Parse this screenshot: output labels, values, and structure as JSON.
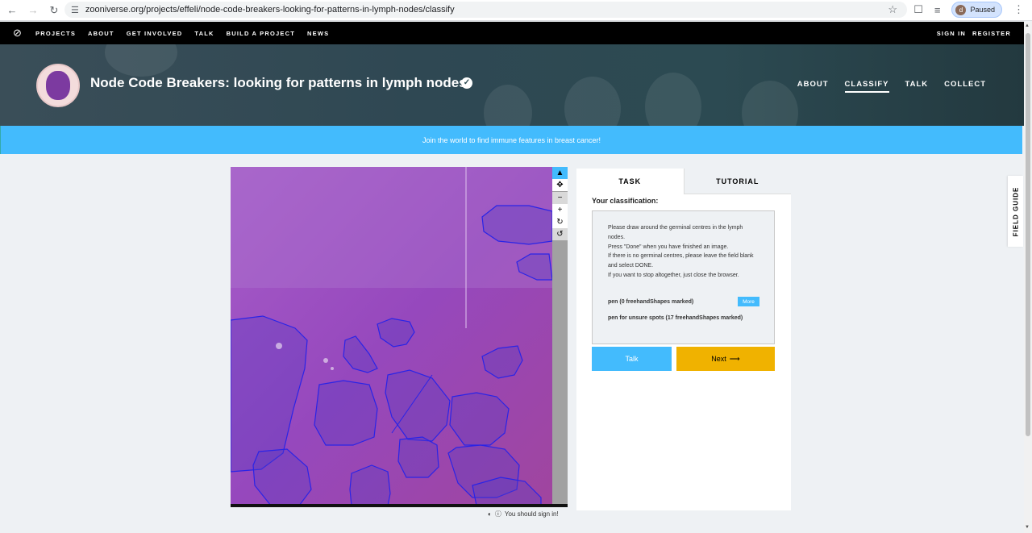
{
  "browser": {
    "url": "zooniverse.org/projects/effeli/node-code-breakers-looking-for-patterns-in-lymph-nodes/classify",
    "profile_initial": "d",
    "profile_status": "Paused"
  },
  "topnav": {
    "items": [
      "PROJECTS",
      "ABOUT",
      "GET INVOLVED",
      "TALK",
      "BUILD A PROJECT",
      "NEWS"
    ],
    "sign_in": "SIGN IN",
    "register": "REGISTER"
  },
  "project": {
    "title": "Node Code Breakers: looking for patterns in lymph nodes",
    "nav": [
      "ABOUT",
      "CLASSIFY",
      "TALK",
      "COLLECT"
    ],
    "active_nav": "CLASSIFY"
  },
  "banner": "Join the world to find immune features in breast cancer!",
  "panel": {
    "tabs": [
      "TASK",
      "TUTORIAL"
    ],
    "active_tab": "TASK",
    "classification_label": "Your classification:",
    "instructions": [
      "Please draw around the germinal centres in the lymph nodes.",
      "Press \"Done\" when you have finished an image.",
      "If there is no germinal centres, please leave the field blank and select DONE.",
      "If you want to stop altogether, just close the browser."
    ],
    "tools": [
      {
        "label": "pen (0 freehandShapes marked)"
      },
      {
        "label": "pen for unsure spots (17 freehandShapes marked)"
      }
    ],
    "more_label": "More",
    "talk_label": "Talk",
    "next_label": "Next",
    "next_icon": "arrow-right-icon"
  },
  "viewer": {
    "tools": [
      "pointer-icon",
      "move-icon",
      "zoom-out-icon",
      "zoom-in-icon",
      "rotate-icon",
      "reset-icon"
    ],
    "signin_note": "You should sign in!"
  },
  "field_guide": "FIELD GUIDE",
  "colors": {
    "accent_blue": "#43bbfd",
    "next_yellow": "#f0b200",
    "tissue_purple": "#9a4fc2",
    "outline_blue": "#2a24e6"
  }
}
